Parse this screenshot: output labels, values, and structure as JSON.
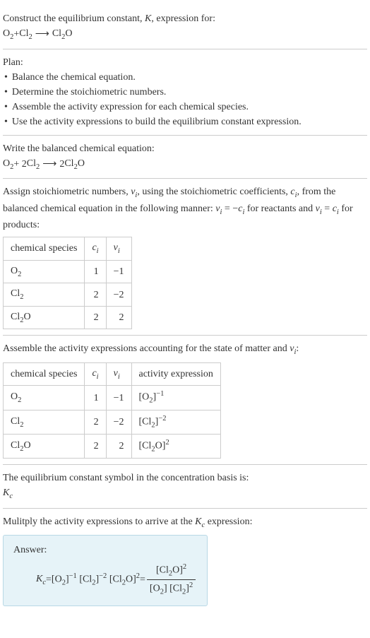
{
  "intro": {
    "line1": "Construct the equilibrium constant, ",
    "k": "K",
    "line1b": ", expression for:",
    "eq_lhs_o2": "O",
    "eq_lhs_plus": " + ",
    "eq_lhs_cl2": "Cl",
    "arrow": "⟶",
    "eq_rhs_cl2o": "Cl",
    "eq_rhs_o": "O"
  },
  "plan": {
    "title": "Plan:",
    "items": [
      "Balance the chemical equation.",
      "Determine the stoichiometric numbers.",
      "Assemble the activity expression for each chemical species.",
      "Use the activity expressions to build the equilibrium constant expression."
    ]
  },
  "balanced": {
    "title": "Write the balanced chemical equation:",
    "c1": "O",
    "plus": " + 2 ",
    "c2": "Cl",
    "arrow": "⟶",
    "rhs_coef": " 2 ",
    "c3": "Cl",
    "c3o": "O"
  },
  "assign": {
    "text1": "Assign stoichiometric numbers, ",
    "nu": "ν",
    "i": "i",
    "text2": ", using the stoichiometric coefficients, ",
    "c": "c",
    "text3": ", from the balanced chemical equation in the following manner: ",
    "eq1_l": "ν",
    "eq1_eq": " = −",
    "eq1_r": "c",
    "text4": " for reactants and ",
    "eq2_l": "ν",
    "eq2_eq": " = ",
    "eq2_r": "c",
    "text5": " for products:",
    "table": {
      "headers": {
        "h1": "chemical species",
        "h2": "c",
        "h2i": "i",
        "h3": "ν",
        "h3i": "i"
      },
      "rows": [
        {
          "sp": "O",
          "sub": "2",
          "c": "1",
          "nu": "−1"
        },
        {
          "sp": "Cl",
          "sub": "2",
          "c": "2",
          "nu": "−2"
        },
        {
          "sp": "Cl",
          "sub": "2",
          "sp2": "O",
          "c": "2",
          "nu": "2"
        }
      ]
    }
  },
  "activity": {
    "text1": "Assemble the activity expressions accounting for the state of matter and ",
    "nu": "ν",
    "i": "i",
    "colon": ":",
    "table": {
      "h1": "chemical species",
      "h2": "c",
      "h2i": "i",
      "h3": "ν",
      "h3i": "i",
      "h4": "activity expression",
      "rows": [
        {
          "sp": "O",
          "sub": "2",
          "c": "1",
          "nu": "−1",
          "act_sp": "O",
          "act_sub": "2",
          "act_exp": "−1"
        },
        {
          "sp": "Cl",
          "sub": "2",
          "c": "2",
          "nu": "−2",
          "act_sp": "Cl",
          "act_sub": "2",
          "act_exp": "−2"
        },
        {
          "sp": "Cl",
          "sub": "2",
          "sp2": "O",
          "c": "2",
          "nu": "2",
          "act_sp": "Cl",
          "act_sub": "2",
          "act_sp2": "O",
          "act_exp": "2"
        }
      ]
    }
  },
  "basis": {
    "text": "The equilibrium constant symbol in the concentration basis is:",
    "k": "K",
    "c": "c"
  },
  "multiply": {
    "text": "Mulitply the activity expressions to arrive at the ",
    "k": "K",
    "c": "c",
    "text2": " expression:"
  },
  "answer": {
    "label": "Answer:",
    "k": "K",
    "c": "c",
    "eq": " = ",
    "t1_sp": "O",
    "t1_sub": "2",
    "t1_exp": "−1",
    "t2_sp": "Cl",
    "t2_sub": "2",
    "t2_exp": "−2",
    "t3_sp": "Cl",
    "t3_sub": "2",
    "t3_sp2": "O",
    "t3_exp": "2",
    "eq2": " = ",
    "num_sp": "Cl",
    "num_sub": "2",
    "num_sp2": "O",
    "num_exp": "2",
    "den1_sp": "O",
    "den1_sub": "2",
    "den2_sp": "Cl",
    "den2_sub": "2",
    "den2_exp": "2"
  }
}
